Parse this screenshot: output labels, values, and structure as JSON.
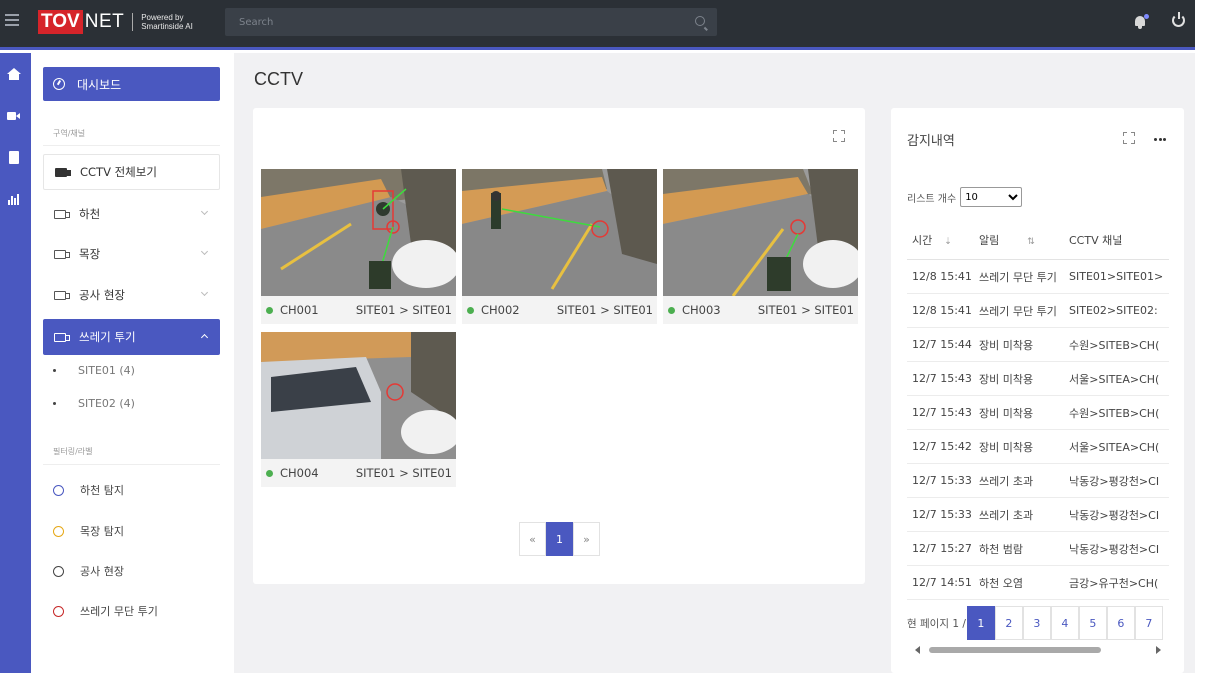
{
  "header": {
    "logo_tov": "TOV",
    "logo_net": "NET",
    "powered_line1": "Powered by",
    "powered_line2": "Smartinside AI",
    "search_placeholder": "Search"
  },
  "sidebar": {
    "dashboard": "대시보드",
    "section_zone": "구역/채널",
    "all_cctv": "CCTV 전체보기",
    "groups": [
      {
        "label": "하천"
      },
      {
        "label": "목장"
      },
      {
        "label": "공사 현장"
      },
      {
        "label": "쓰레기 투기"
      }
    ],
    "sub_items": [
      "SITE01 (4)",
      "SITE02 (4)"
    ],
    "section_filter": "필터링/라벨",
    "filters": [
      {
        "label": "하천 탐지",
        "color": "#4a58c0"
      },
      {
        "label": "목장 탐지",
        "color": "#e6a817"
      },
      {
        "label": "공사 현장",
        "color": "#444444"
      },
      {
        "label": "쓰레기 무단 투기",
        "color": "#c62828"
      }
    ]
  },
  "main": {
    "page_title": "CCTV",
    "tiles": [
      {
        "channel": "CH001",
        "site": "SITE01 > SITE01"
      },
      {
        "channel": "CH002",
        "site": "SITE01 > SITE01"
      },
      {
        "channel": "CH003",
        "site": "SITE01 > SITE01"
      },
      {
        "channel": "CH004",
        "site": "SITE01 > SITE01"
      }
    ],
    "pager": {
      "prev": "«",
      "current": "1",
      "next": "»"
    }
  },
  "detection": {
    "title": "감지내역",
    "list_count_label": "리스트 개수",
    "list_count_value": "10",
    "columns": {
      "time": "시간",
      "alarm": "알림",
      "channel": "CCTV 채널"
    },
    "rows": [
      {
        "time": "12/8 15:41",
        "alarm": "쓰레기 무단 투기",
        "channel": "SITE01>SITE01>"
      },
      {
        "time": "12/8 15:41",
        "alarm": "쓰레기 무단 투기",
        "channel": "SITE02>SITE02:"
      },
      {
        "time": "12/7 15:44",
        "alarm": "장비 미착용",
        "channel": "수원>SITEB>CH("
      },
      {
        "time": "12/7 15:43",
        "alarm": "장비 미착용",
        "channel": "서울>SITEA>CH("
      },
      {
        "time": "12/7 15:43",
        "alarm": "장비 미착용",
        "channel": "수원>SITEB>CH("
      },
      {
        "time": "12/7 15:42",
        "alarm": "장비 미착용",
        "channel": "서울>SITEA>CH("
      },
      {
        "time": "12/7 15:33",
        "alarm": "쓰레기 초과",
        "channel": "낙동강>평강천>CI"
      },
      {
        "time": "12/7 15:33",
        "alarm": "쓰레기 초과",
        "channel": "낙동강>평강천>CI"
      },
      {
        "time": "12/7 15:27",
        "alarm": "하천 범람",
        "channel": "낙동강>평강천>CI"
      },
      {
        "time": "12/7 14:51",
        "alarm": "하천 오염",
        "channel": "금강>유구천>CH("
      }
    ],
    "page_label": "현 페이지 1 /",
    "pages": [
      "1",
      "2",
      "3",
      "4",
      "5",
      "6",
      "7"
    ]
  },
  "colors": {
    "accent": "#4a58c0",
    "topbar": "#2b3036",
    "brand_red": "#d6242a",
    "live_green": "#4caf50"
  }
}
